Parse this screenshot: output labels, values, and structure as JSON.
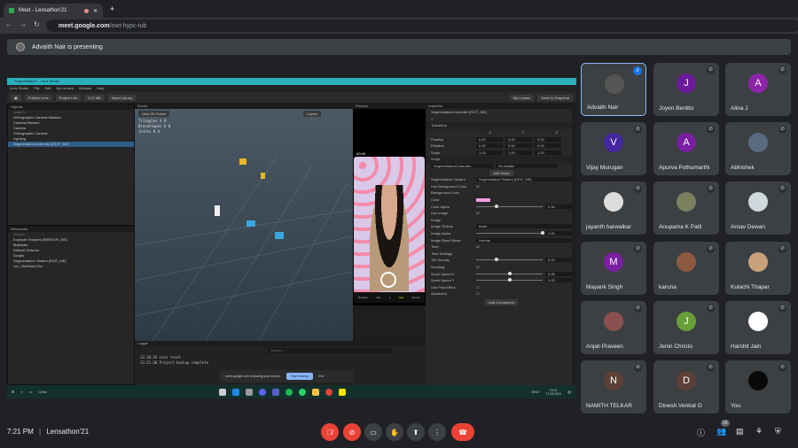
{
  "browser": {
    "tab_title": "Meet - Lensathon'21",
    "url_host": "meet.google.com",
    "url_path": "/owt-hypc-iub"
  },
  "banner": {
    "text": "Advaith Nair is presenting"
  },
  "lens_studio": {
    "title": "Segmentation* - Lens Studio",
    "menu": [
      "Lens Studio",
      "File",
      "Edit",
      "My Lenses",
      "Window",
      "Help"
    ],
    "toolbar": {
      "publish": "Publish Lens",
      "project_info": "Project Info",
      "size": "0.21 MB",
      "asset_library": "Asset Library",
      "my_lenses": "My Lenses",
      "send": "Send to Snapchat"
    },
    "objects": {
      "tab": "Objects",
      "tab2": "Scene Config",
      "search": "Search...",
      "items": [
        "Orthographic Camera Masked",
        "Camera Masked",
        "Camera",
        "Orthographic Camera",
        "Lighting",
        "SegmentationController [EDIT_ME]"
      ]
    },
    "resources": {
      "tab": "Resources",
      "search": "Search...",
      "items": [
        "Example Textures [REMOVE_ME]",
        "Materials",
        "Default Textures",
        "Scripts",
        "Segmentation Texture [EDIT_ME]",
        "cvs_Vfu50kk14Toz"
      ]
    },
    "scene": {
      "tab": "Scene",
      "tab2": "Material Editor",
      "view2d": "View 2D Scene",
      "layers": "Layers",
      "stats": [
        [
          "Triangles",
          "4",
          "0"
        ],
        [
          "Blendshapes",
          "0",
          "0"
        ],
        [
          "Joints",
          "0",
          "0"
        ]
      ]
    },
    "preview": {
      "tab": "Preview",
      "time": "00:00",
      "bottom": [
        "Memories",
        "Chat",
        "",
        "Lens",
        "Discover"
      ]
    },
    "inspector": {
      "tab": "Inspector",
      "object": "SegmentationController [EDIT_ME]",
      "transform": "Transform",
      "axes": [
        "X",
        "Y",
        "Z"
      ],
      "rows": [
        {
          "label": "Position",
          "v": [
            "0.00",
            "0.00",
            "0.00"
          ]
        },
        {
          "label": "Rotation",
          "v": [
            "0.00",
            "0.00",
            "0.00"
          ]
        },
        {
          "label": "Scale",
          "v": [
            "1.00",
            "1.00",
            "1.00"
          ]
        }
      ],
      "script": "Script",
      "script_name": "SegmentationController",
      "event": "On Awake",
      "add_script": "Add Script",
      "props": {
        "seg_tex": "Segmentation Texture",
        "seg_tex_val": "Segmentation Texture [EDIT_ME]",
        "use_bg": "Use Background Color",
        "bg": "Background Color",
        "color": "Color",
        "color_val": "#f29ee0",
        "alpha": "Color Alpha",
        "alpha_val": "0.30",
        "alpha_frac": 0.3,
        "use_image": "Use Image",
        "image": "Image",
        "img_tex": "Image Texture",
        "img_tex_val": "heart",
        "img_alpha": "Image Alpha",
        "img_alpha_val": "1.00",
        "img_alpha_frac": 1.0,
        "blend": "Image Blend Mode",
        "blend_val": "Normal",
        "tiled": "Tiled",
        "tiled_settings": "Tiled Settings",
        "density": "Tile Density",
        "density_val": "6.00",
        "density_frac": 0.3,
        "scrolling": "Scrolling",
        "sx": "Scroll Speed X",
        "sx_val": "0.25",
        "sy": "Scroll Speed Y",
        "sy_val": "0.25",
        "speed_frac": 0.5,
        "post": "Use Post Effect",
        "advanced": "Advanced"
      },
      "add_component": "Add Component"
    },
    "logger": {
      "tab": "Logger",
      "search": "Search...",
      "lines": [
        "13:20:34 Lens reset",
        "13:21:30 Project backup complete"
      ]
    },
    "sharing": {
      "text": "meet.google.com is sharing your screen.",
      "stop": "Stop sharing",
      "hide": "Hide"
    },
    "taskbar": {
      "links": "Links",
      "time": "19:21",
      "date": "17-09-2021",
      "lang": "ENG"
    }
  },
  "participants": [
    {
      "name": "Advaith Nair",
      "initial": "",
      "color": "#555",
      "speaking": true
    },
    {
      "name": "Joyen Benitto",
      "initial": "J",
      "color": "#6a1b9a"
    },
    {
      "name": "Alina J",
      "initial": "A",
      "color": "#8e24aa"
    },
    {
      "name": "Vijay Murugan",
      "initial": "V",
      "color": "#4527a0"
    },
    {
      "name": "Apurva Pothumarthi",
      "initial": "A",
      "color": "#7b1fa2"
    },
    {
      "name": "Abhishek",
      "initial": "",
      "color": "#5a6b80"
    },
    {
      "name": "jayanth harwalkar",
      "initial": "",
      "color": "#ddd"
    },
    {
      "name": "Anupama K Patil",
      "initial": "",
      "color": "#7a8060"
    },
    {
      "name": "Arnav Dewan",
      "initial": "",
      "color": "#cfd8dc"
    },
    {
      "name": "Mayank Singh",
      "initial": "M",
      "color": "#7b1fa2"
    },
    {
      "name": "karuna",
      "initial": "",
      "color": "#8d5a40"
    },
    {
      "name": "Kulachi Thapar",
      "initial": "",
      "color": "#c9a07a"
    },
    {
      "name": "Anjali Praveen",
      "initial": "",
      "color": "#8a5050"
    },
    {
      "name": "Jenin Christo",
      "initial": "J",
      "color": "#689f38"
    },
    {
      "name": "Harshit Jain",
      "initial": "",
      "color": "#ffffff"
    },
    {
      "name": "NAMITH TELKAR",
      "initial": "N",
      "color": "#5d4037"
    },
    {
      "name": "Dinesh Venkat G",
      "initial": "D",
      "color": "#5d4037"
    },
    {
      "name": "You",
      "initial": "",
      "color": "#0a0a0a"
    }
  ],
  "bottom": {
    "time": "7:21 PM",
    "meeting": "Lensathon'21",
    "people_count": "19"
  }
}
